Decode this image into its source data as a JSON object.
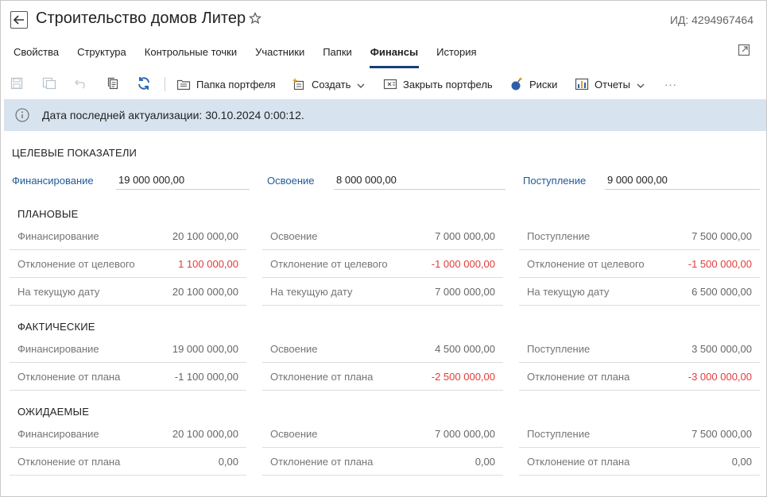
{
  "header": {
    "title": "Строительство домов Литер",
    "id_label": "ИД: 4294967464"
  },
  "tabs": [
    {
      "label": "Свойства"
    },
    {
      "label": "Структура"
    },
    {
      "label": "Контрольные точки"
    },
    {
      "label": "Участники"
    },
    {
      "label": "Папки"
    },
    {
      "label": "Финансы",
      "active": true
    },
    {
      "label": "История"
    }
  ],
  "toolbar": {
    "portfolio_folder": "Папка портфеля",
    "create": "Создать",
    "close_portfolio": "Закрыть портфель",
    "risks": "Риски",
    "reports": "Отчеты",
    "more": "···"
  },
  "info": {
    "text": "Дата последней актуализации: 30.10.2024 0:00:12."
  },
  "targets": {
    "title": "ЦЕЛЕВЫЕ ПОКАЗАТЕЛИ",
    "items": [
      {
        "label": "Финансирование",
        "value": "19 000 000,00"
      },
      {
        "label": "Освоение",
        "value": "8 000 000,00"
      },
      {
        "label": "Поступление",
        "value": "9 000 000,00"
      }
    ]
  },
  "planned": {
    "title": "ПЛАНОВЫЕ",
    "columns": [
      [
        {
          "label": "Финансирование",
          "value": "20 100 000,00"
        },
        {
          "label": "Отклонение от целевого",
          "value": "1 100 000,00",
          "negative": true
        },
        {
          "label": "На текущую дату",
          "value": "20 100 000,00"
        }
      ],
      [
        {
          "label": "Освоение",
          "value": "7 000 000,00"
        },
        {
          "label": "Отклонение от целевого",
          "value": "-1 000 000,00",
          "negative": true
        },
        {
          "label": "На текущую дату",
          "value": "7 000 000,00"
        }
      ],
      [
        {
          "label": "Поступление",
          "value": "7 500 000,00"
        },
        {
          "label": "Отклонение от целевого",
          "value": "-1 500 000,00",
          "negative": true
        },
        {
          "label": "На текущую дату",
          "value": "6 500 000,00"
        }
      ]
    ]
  },
  "actual": {
    "title": "ФАКТИЧЕСКИЕ",
    "columns": [
      [
        {
          "label": "Финансирование",
          "value": "19 000 000,00"
        },
        {
          "label": "Отклонение от плана",
          "value": "-1 100 000,00"
        }
      ],
      [
        {
          "label": "Освоение",
          "value": "4 500 000,00"
        },
        {
          "label": "Отклонение от плана",
          "value": "-2 500 000,00",
          "negative": true
        }
      ],
      [
        {
          "label": "Поступление",
          "value": "3 500 000,00"
        },
        {
          "label": "Отклонение от плана",
          "value": "-3 000 000,00",
          "negative": true
        }
      ]
    ]
  },
  "expected": {
    "title": "ОЖИДАЕМЫЕ",
    "columns": [
      [
        {
          "label": "Финансирование",
          "value": "20 100 000,00"
        },
        {
          "label": "Отклонение от плана",
          "value": "0,00"
        }
      ],
      [
        {
          "label": "Освоение",
          "value": "7 000 000,00"
        },
        {
          "label": "Отклонение от плана",
          "value": "0,00"
        }
      ],
      [
        {
          "label": "Поступление",
          "value": "7 500 000,00"
        },
        {
          "label": "Отклонение от плана",
          "value": "0,00"
        }
      ]
    ]
  },
  "colors": {
    "accent": "#1a3f73",
    "link": "#1f5a96",
    "negative": "#e03c3c",
    "info_bg": "#d7e3ef"
  }
}
